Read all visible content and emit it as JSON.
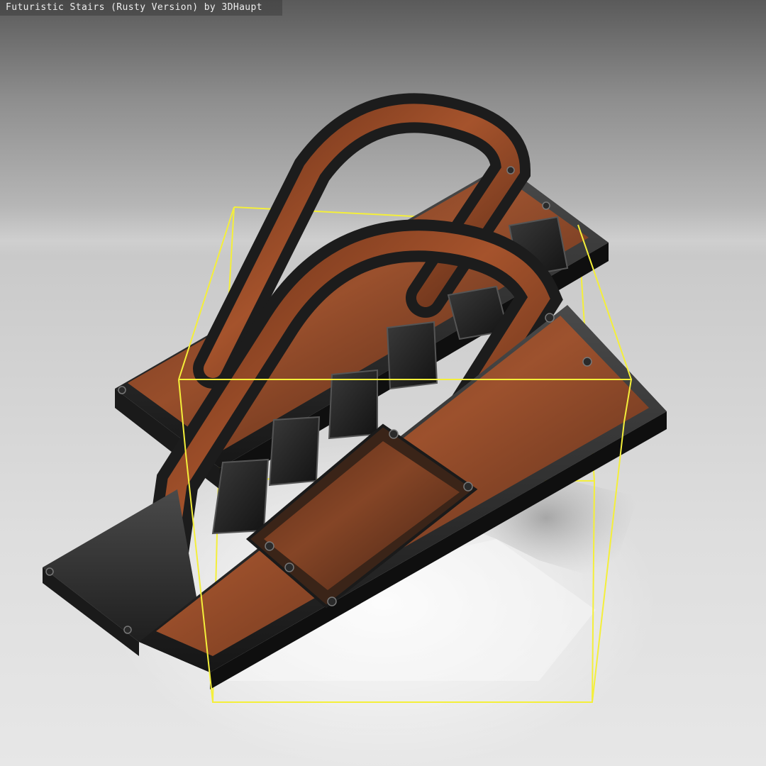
{
  "viewer": {
    "title": "Futuristic Stairs (Rusty Version) by 3DHaupt"
  },
  "colors": {
    "selection_box": "#f4ef3a",
    "rust": "#9a4a28",
    "metal_dark": "#262626",
    "background_top": "#5a5a5a",
    "background_bottom": "#e7e7e7"
  }
}
